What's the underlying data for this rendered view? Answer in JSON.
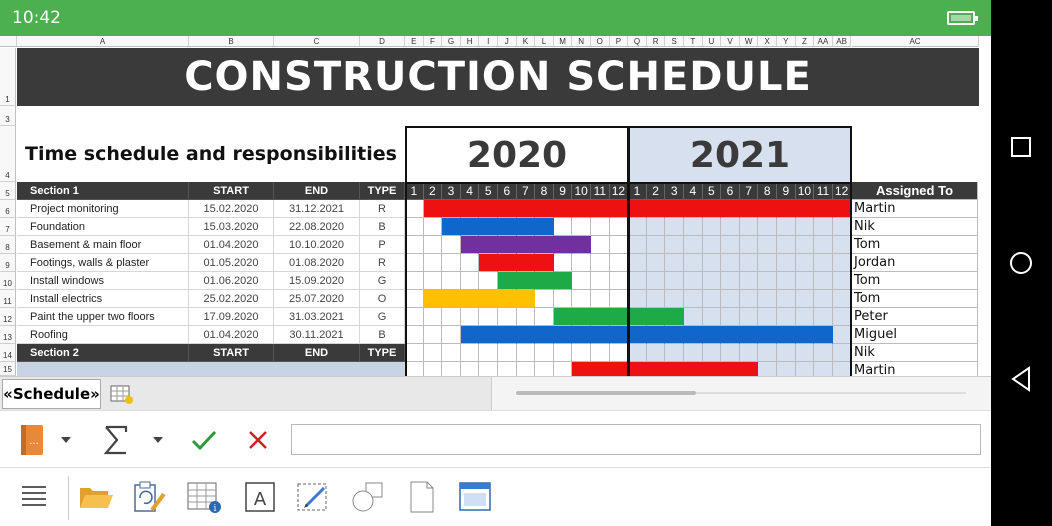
{
  "status": {
    "time": "10:42"
  },
  "columns": [
    "A",
    "B",
    "C",
    "D",
    "E",
    "F",
    "G",
    "H",
    "I",
    "J",
    "K",
    "L",
    "M",
    "N",
    "O",
    "P",
    "Q",
    "R",
    "S",
    "T",
    "U",
    "V",
    "W",
    "X",
    "Y",
    "Z",
    "AA",
    "AB",
    "AC"
  ],
  "row_numbers": [
    "1",
    "3",
    "4",
    "5",
    "6",
    "7",
    "8",
    "9",
    "10",
    "11",
    "12",
    "13",
    "14",
    "15"
  ],
  "sheet": {
    "title": "CONSTRUCTION SCHEDULE",
    "subtitle": "Time schedule and responsibilities",
    "years": [
      "2020",
      "2021"
    ],
    "months": [
      "1",
      "2",
      "3",
      "4",
      "5",
      "6",
      "7",
      "8",
      "9",
      "10",
      "11",
      "12"
    ],
    "headers": {
      "start": "START",
      "end": "END",
      "type": "TYPE",
      "assigned": "Assigned To"
    },
    "sections": [
      {
        "name": "Section 1"
      },
      {
        "name": "Section 2"
      }
    ],
    "tasks": [
      {
        "name": "Project monitoring",
        "start": "15.02.2020",
        "end": "31.12.2021",
        "type": "R",
        "assigned": "Martin",
        "bar_from": 2,
        "bar_to": 24,
        "color": "#ee1111"
      },
      {
        "name": "Foundation",
        "start": "15.03.2020",
        "end": "22.08.2020",
        "type": "B",
        "assigned": "Nik",
        "bar_from": 3,
        "bar_to": 8,
        "color": "#1166cc"
      },
      {
        "name": "Basement & main floor",
        "start": "01.04.2020",
        "end": "10.10.2020",
        "type": "P",
        "assigned": "Tom",
        "bar_from": 4,
        "bar_to": 10,
        "color": "#7030a0"
      },
      {
        "name": "Footings, walls & plaster",
        "start": "01.05.2020",
        "end": "01.08.2020",
        "type": "R",
        "assigned": "Jordan",
        "bar_from": 5,
        "bar_to": 8,
        "color": "#ee1111"
      },
      {
        "name": "Install windows",
        "start": "01.06.2020",
        "end": "15.09.2020",
        "type": "G",
        "assigned": "Tom",
        "bar_from": 6,
        "bar_to": 9,
        "color": "#1faa48"
      },
      {
        "name": "Install electrics",
        "start": "25.02.2020",
        "end": "25.07.2020",
        "type": "O",
        "assigned": "Tom",
        "bar_from": 2,
        "bar_to": 7,
        "color": "#ffc000"
      },
      {
        "name": "Paint the upper two floors",
        "start": "17.09.2020",
        "end": "31.03.2021",
        "type": "G",
        "assigned": "Peter",
        "bar_from": 9,
        "bar_to": 15,
        "color": "#1faa48"
      },
      {
        "name": "Roofing",
        "start": "01.04.2020",
        "end": "30.11.2021",
        "type": "B",
        "assigned": "Miguel",
        "bar_from": 4,
        "bar_to": 23,
        "color": "#1166cc"
      }
    ],
    "section2_assigned": "Nik",
    "partial_row_assigned": "Martin"
  },
  "tabs": {
    "active": "«Schedule»"
  },
  "colors": {
    "title_bg": "#3a3a3a",
    "status_bar": "#4caf50",
    "year2021_bg": "#d6e0ee"
  }
}
